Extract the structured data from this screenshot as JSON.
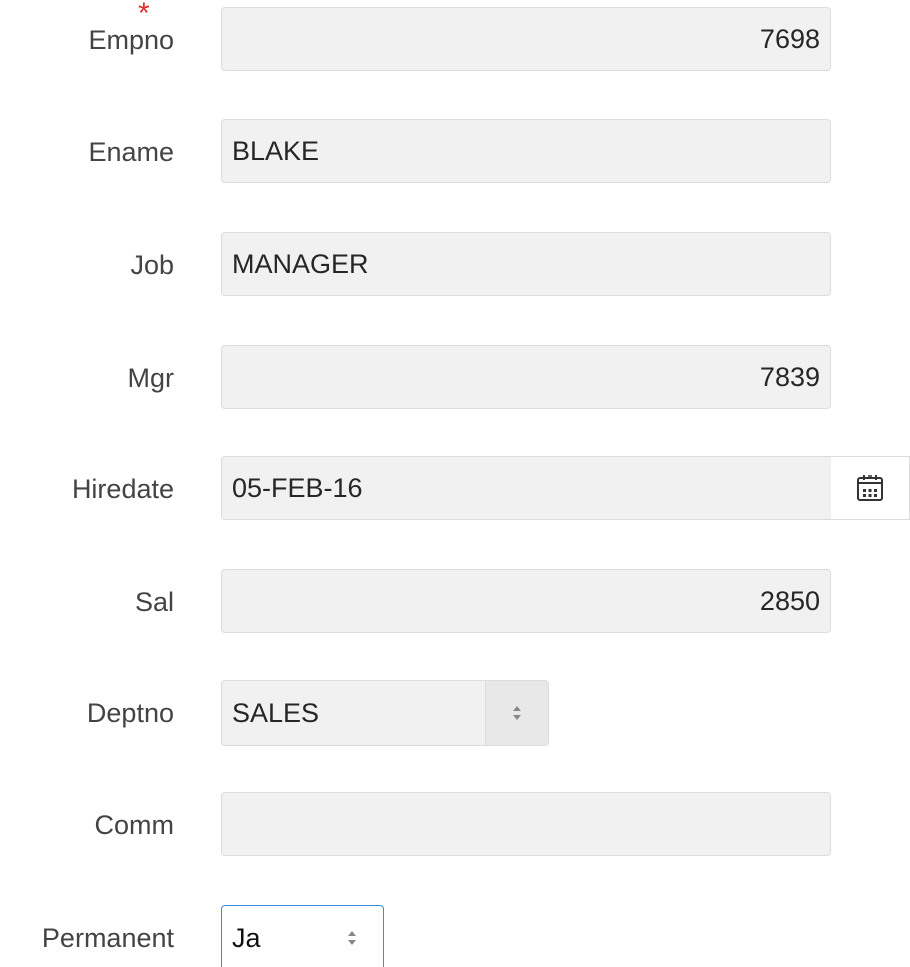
{
  "form": {
    "fields": [
      {
        "key": "empno",
        "label": "Empno",
        "value": "7698",
        "required": true
      },
      {
        "key": "ename",
        "label": "Ename",
        "value": "BLAKE"
      },
      {
        "key": "job",
        "label": "Job",
        "value": "MANAGER"
      },
      {
        "key": "mgr",
        "label": "Mgr",
        "value": "7839"
      },
      {
        "key": "hiredate",
        "label": "Hiredate",
        "value": "05-FEB-16",
        "button_icon": "calendar-icon"
      },
      {
        "key": "sal",
        "label": "Sal",
        "value": "2850"
      },
      {
        "key": "deptno",
        "label": "Deptno",
        "value": "SALES",
        "control": "select"
      },
      {
        "key": "comm",
        "label": "Comm",
        "value": ""
      },
      {
        "key": "permanent",
        "label": "Permanent",
        "value": "Ja",
        "control": "select"
      }
    ],
    "required_marker": "*"
  },
  "colors": {
    "required": "#e03030",
    "focus_border": "#3b8fd9",
    "readonly_bg": "#f1f1f1"
  }
}
